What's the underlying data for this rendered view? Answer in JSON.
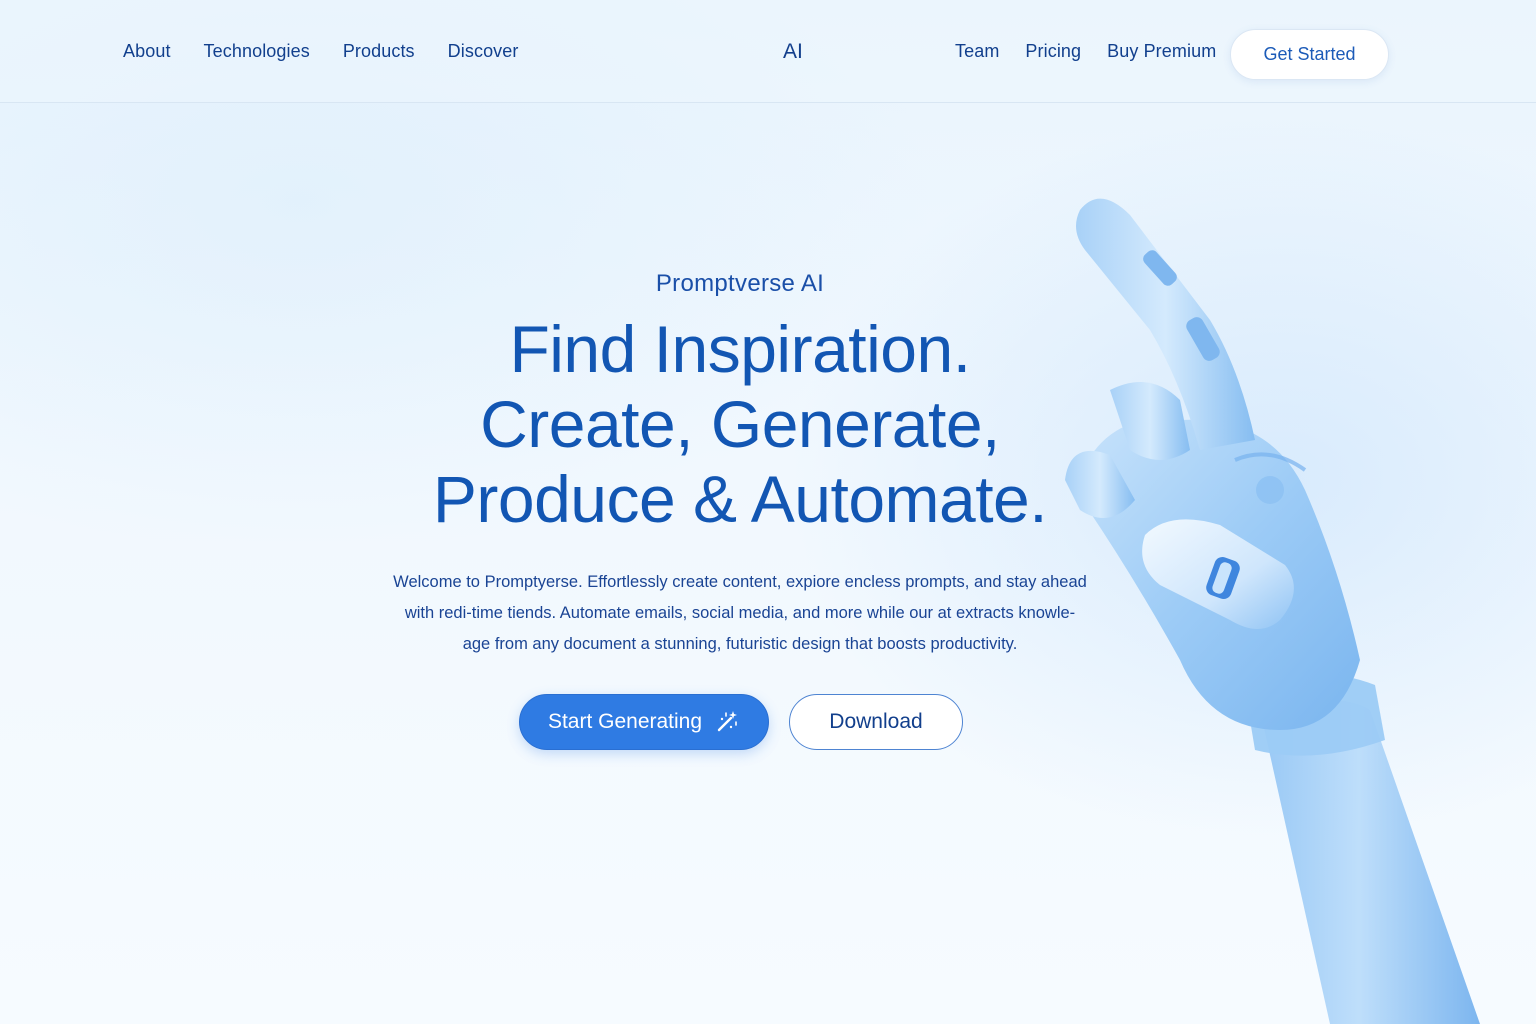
{
  "nav": {
    "left_links": [
      "About",
      "Technologies",
      "Products",
      "Discover"
    ],
    "brand": "AI",
    "right_links": [
      "Team",
      "Pricing",
      "Buy Premium"
    ],
    "cta_label": "Get Started"
  },
  "hero": {
    "eyebrow": "Promptverse AI",
    "headline": [
      "Find Inspiration.",
      "Create, Generate,",
      "Produce & Automate."
    ],
    "description": [
      "Welcome to Promptyerse. Effortlessly create content, expiore encless prompts, and stay ahead",
      "with redi-time tiends. Automate emails, social media, and more while our at extracts knowle-",
      "age from any document a stunning, futuristic design that boosts productivity."
    ],
    "primary_button": "Start Generating",
    "secondary_button": "Download"
  },
  "icons": {
    "primary_button_icon": "magic-wand-icon",
    "hero_image": "robot-hand-illustration"
  },
  "colors": {
    "accent": "#2f7be3",
    "headline": "#1256b3",
    "text": "#113f8d",
    "background": "#eef6fd"
  }
}
